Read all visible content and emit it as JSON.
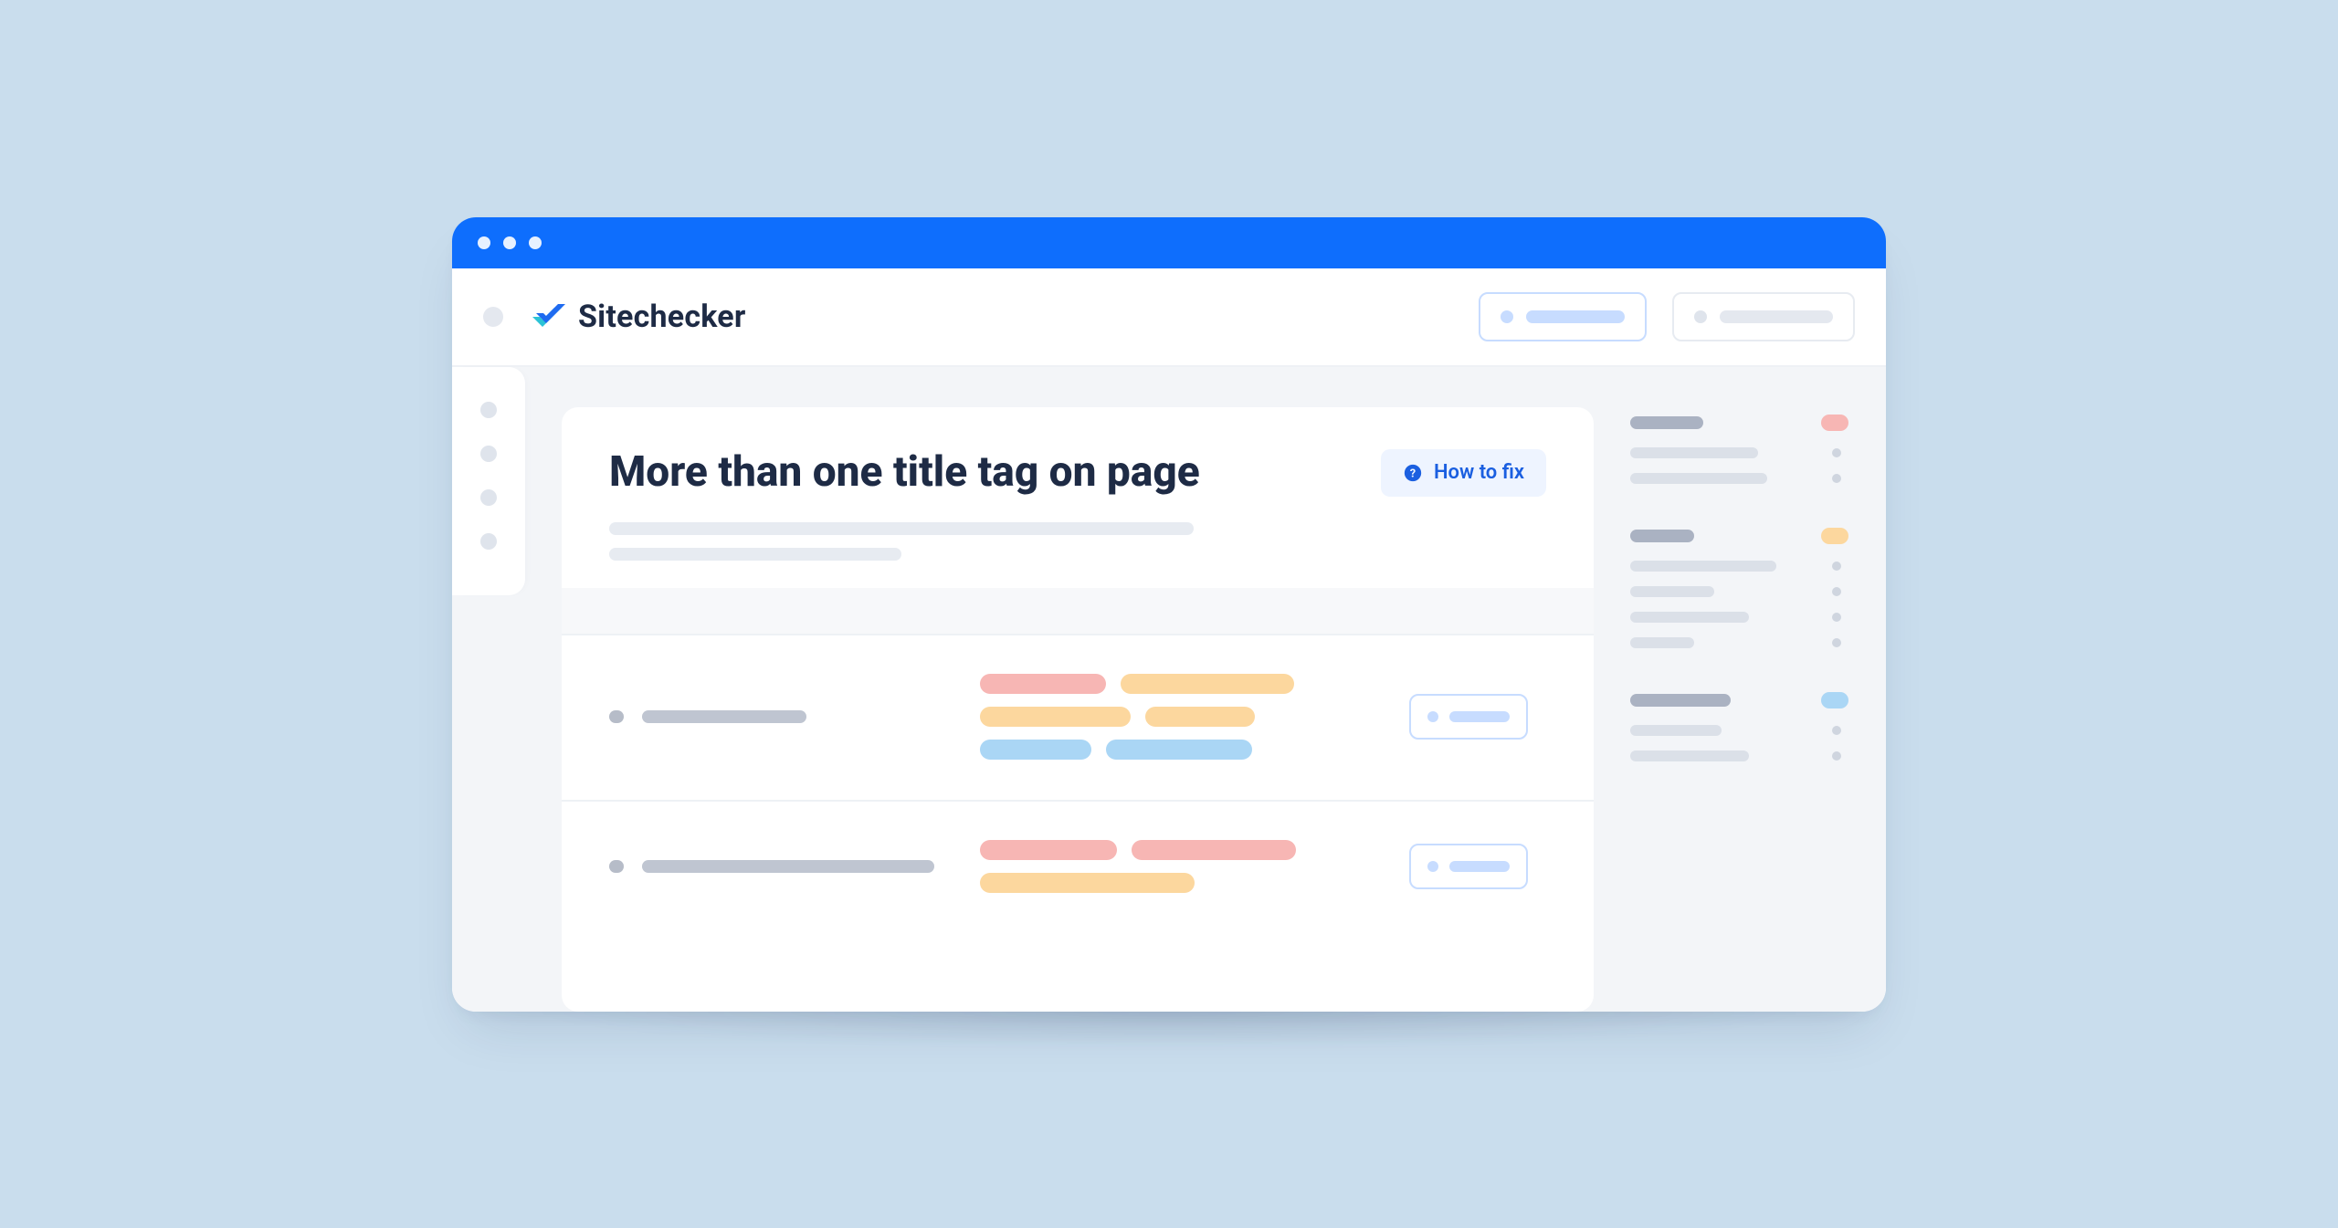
{
  "brand": {
    "name": "Sitechecker"
  },
  "header": {
    "buttons": [
      {
        "kind": "primary"
      },
      {
        "kind": "secondary"
      }
    ]
  },
  "panel": {
    "title": "More than one title tag on page",
    "how_to_fix_label": "How to fix"
  },
  "aside_pills": [
    "red",
    "orange",
    "blue"
  ]
}
